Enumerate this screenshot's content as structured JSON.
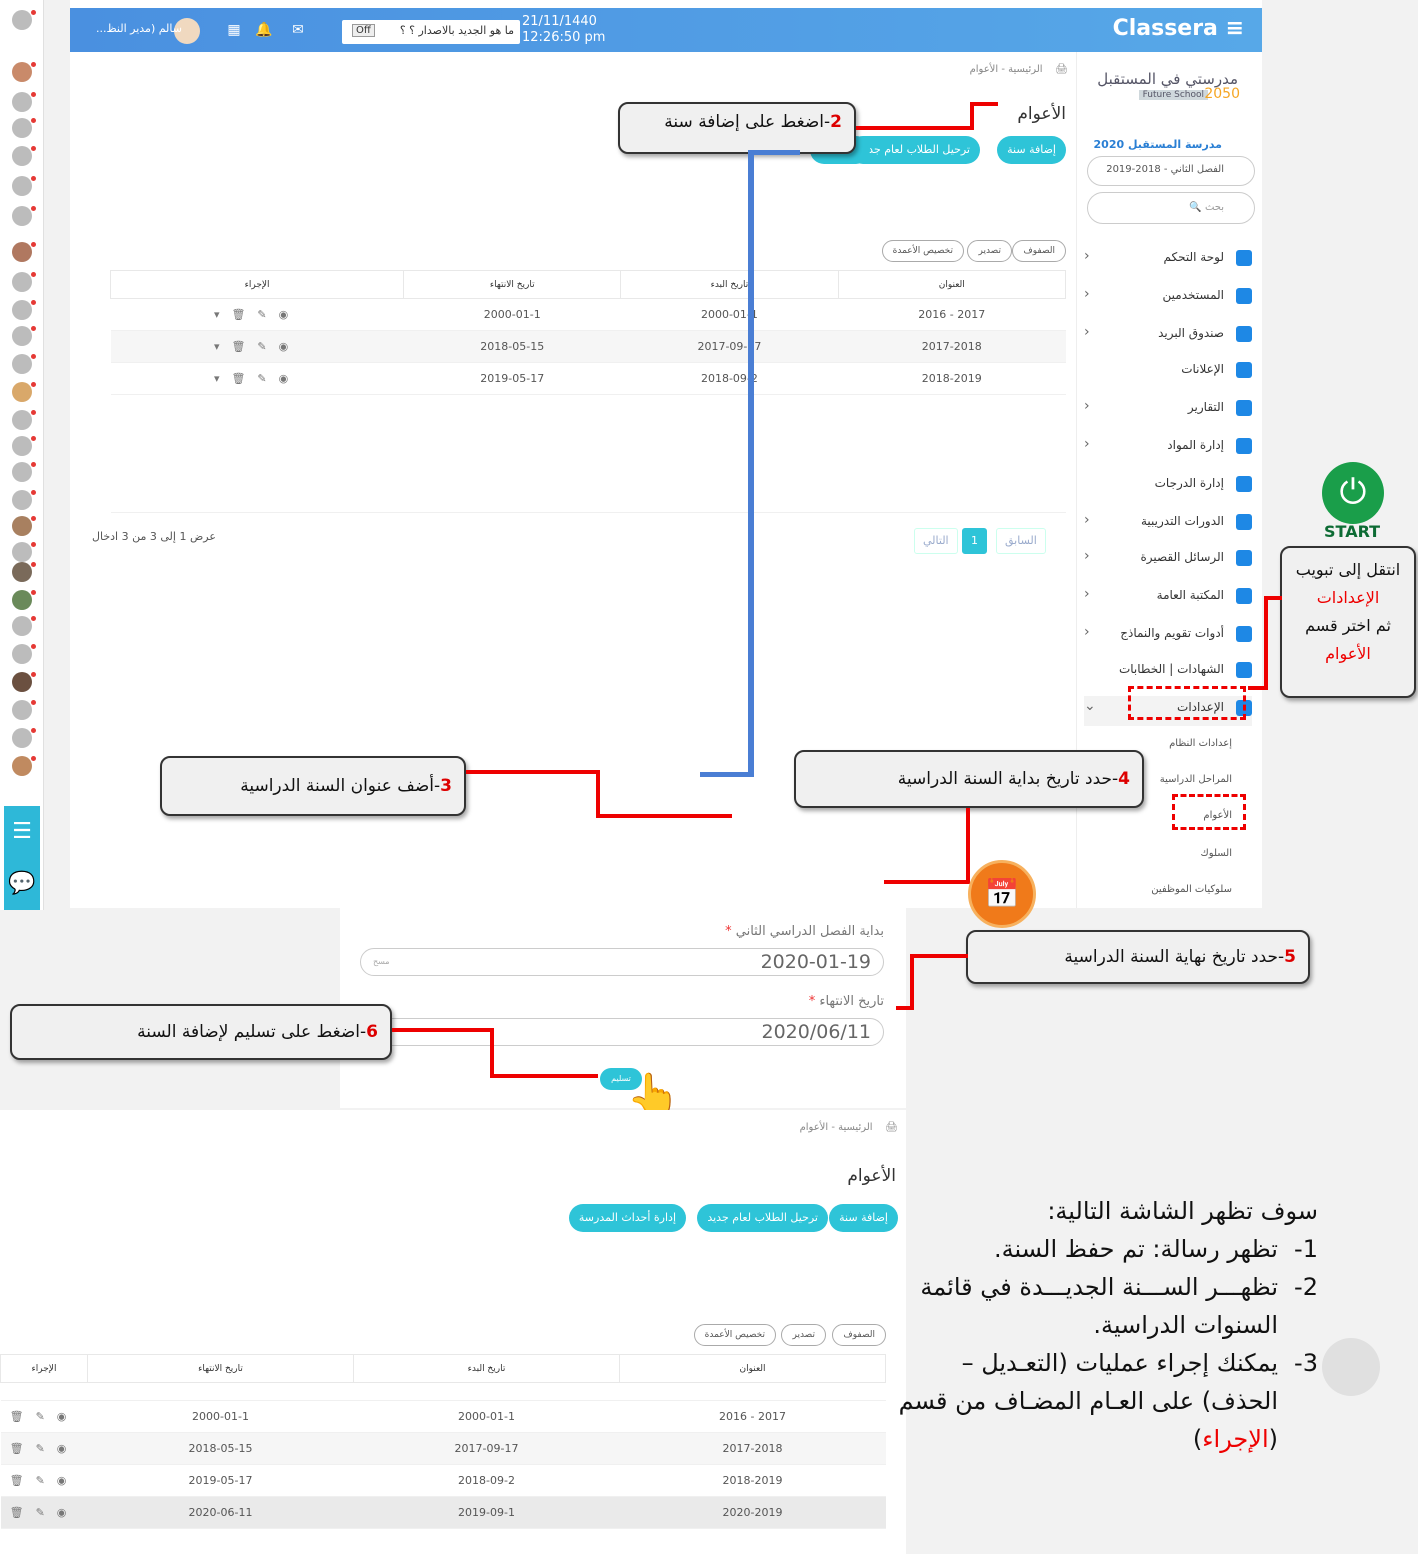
{
  "app": {
    "brand": "Classera",
    "date": "21/11/1440",
    "time": "12:26:50 pm",
    "release_text": "ما هو الجديد بالاصدار ؟ ؟",
    "release_toggle": "Off",
    "user_name": "سالم (مدير النظ...",
    "notif_count_1": "3",
    "notif_count_2": "1"
  },
  "sidebar": {
    "school_logo": "مدرستي في المستقبل",
    "school_logo_sub": "Future School",
    "school_logo_year": "2050",
    "school_name": "مدرسة المستقبل 2020",
    "semester_select": "الفصل الثاني - 2018-2019",
    "search_placeholder": "بحث",
    "items": [
      {
        "label": "لوحة التحكم",
        "color": "#1e88e5"
      },
      {
        "label": "المستخدمين",
        "color": "#1e88e5"
      },
      {
        "label": "صندوق البريد",
        "color": "#1e88e5"
      },
      {
        "label": "الإعلانات",
        "color": "#1e88e5"
      },
      {
        "label": "التقارير",
        "color": "#1e88e5"
      },
      {
        "label": "إدارة المواد",
        "color": "#1e88e5"
      },
      {
        "label": "إدارة الدرجات",
        "color": "#1e88e5"
      },
      {
        "label": "الدورات التدريبية",
        "color": "#1e88e5"
      },
      {
        "label": "الرسائل القصيرة",
        "color": "#1e88e5"
      },
      {
        "label": "المكتبة العامة",
        "color": "#1e88e5"
      },
      {
        "label": "أدوات تقويم والنماذج",
        "color": "#1e88e5"
      },
      {
        "label": "الشهادات | الخطابات",
        "color": "#1e88e5"
      },
      {
        "label": "الإعدادات",
        "color": "#1e88e5"
      }
    ],
    "sub_items": [
      "إعدادات النظام",
      "المراحل الدراسية",
      "الأعوام",
      "السلوك",
      "سلوكيات الموظفين"
    ]
  },
  "content": {
    "breadcrumb": "الرئيسية - الأعوام",
    "title": "الأعوام",
    "btn_add_year": "إضافة سنة",
    "btn_transfer": "ترحيل الطلاب لعام جديد",
    "btn_school_events": "إدارة أحداث المدرسة",
    "btn_rows": "الصفوف",
    "btn_export": "تصدير",
    "btn_columns": "تخصيص الأعمدة",
    "table_headers": [
      "العنوان",
      "تاريخ البدء",
      "تاريخ الانتهاء",
      "الإجراء"
    ],
    "rows": [
      [
        "2017 - 2016",
        "2000-01-1",
        "2000-01-1"
      ],
      [
        "2017-2018",
        "2017-09-17",
        "2018-05-15"
      ],
      [
        "2018-2019",
        "2018-09-2",
        "2019-05-17"
      ]
    ],
    "showing": "عرض 1 إلى 3 من 3 ادخال",
    "pager_prev": "السابق",
    "pager_page": "1",
    "pager_next": "التالي"
  },
  "callouts": {
    "step2_num": "2",
    "step2": "-اضغط على إضافة سنة",
    "step3_num": "3",
    "step3": "-أضف عنوان السنة الدراسية",
    "step4_num": "4",
    "step4": "-حدد تاريخ بداية السنة الدراسية",
    "step5_num": "5",
    "step5": "-حدد تاريخ نهاية السنة الدراسية",
    "step6_num": "6",
    "step6": "-اضغط على تسليم لإضافة السنة",
    "nav_line1": "انتقل إلى تبويب",
    "nav_line2": "الإعدادات",
    "nav_line3": "ثم اختر قسم",
    "nav_line4": "الأعوام",
    "start_label": "START"
  },
  "form": {
    "label_second_term": "بداية الفصل الدراسي الثاني",
    "value_second_term": "2020-01-19",
    "label_end": "تاريخ الانتهاء",
    "value_end": "2020/06/11",
    "clear": "مسح",
    "submit": "تسليم",
    "required_mark": "*"
  },
  "result": {
    "rows": [
      [
        "2017 - 2016",
        "2000-01-1",
        "2000-01-1"
      ],
      [
        "2017-2018",
        "2017-09-17",
        "2018-05-15"
      ],
      [
        "2018-2019",
        "2018-09-2",
        "2019-05-17"
      ],
      [
        "2020-2019",
        "2019-09-1",
        "2020-06-11"
      ]
    ]
  },
  "explain": {
    "intro": "سوف تظهر الشاشة التالية:",
    "item1_n": "1-",
    "item1": "تظهر رسالة: تم حفظ السنة.",
    "item2_n": "2-",
    "item2": "تظهـــر الســـنة الجديـــدة في قائمة السنوات الدراسية.",
    "item3_n": "3-",
    "item3": "يمكنك إجراء عمليات (التعـديل – الحذف) على العـام المضـاف من قسم (",
    "item3_red": "الإجراء",
    "item3_end": ")"
  }
}
